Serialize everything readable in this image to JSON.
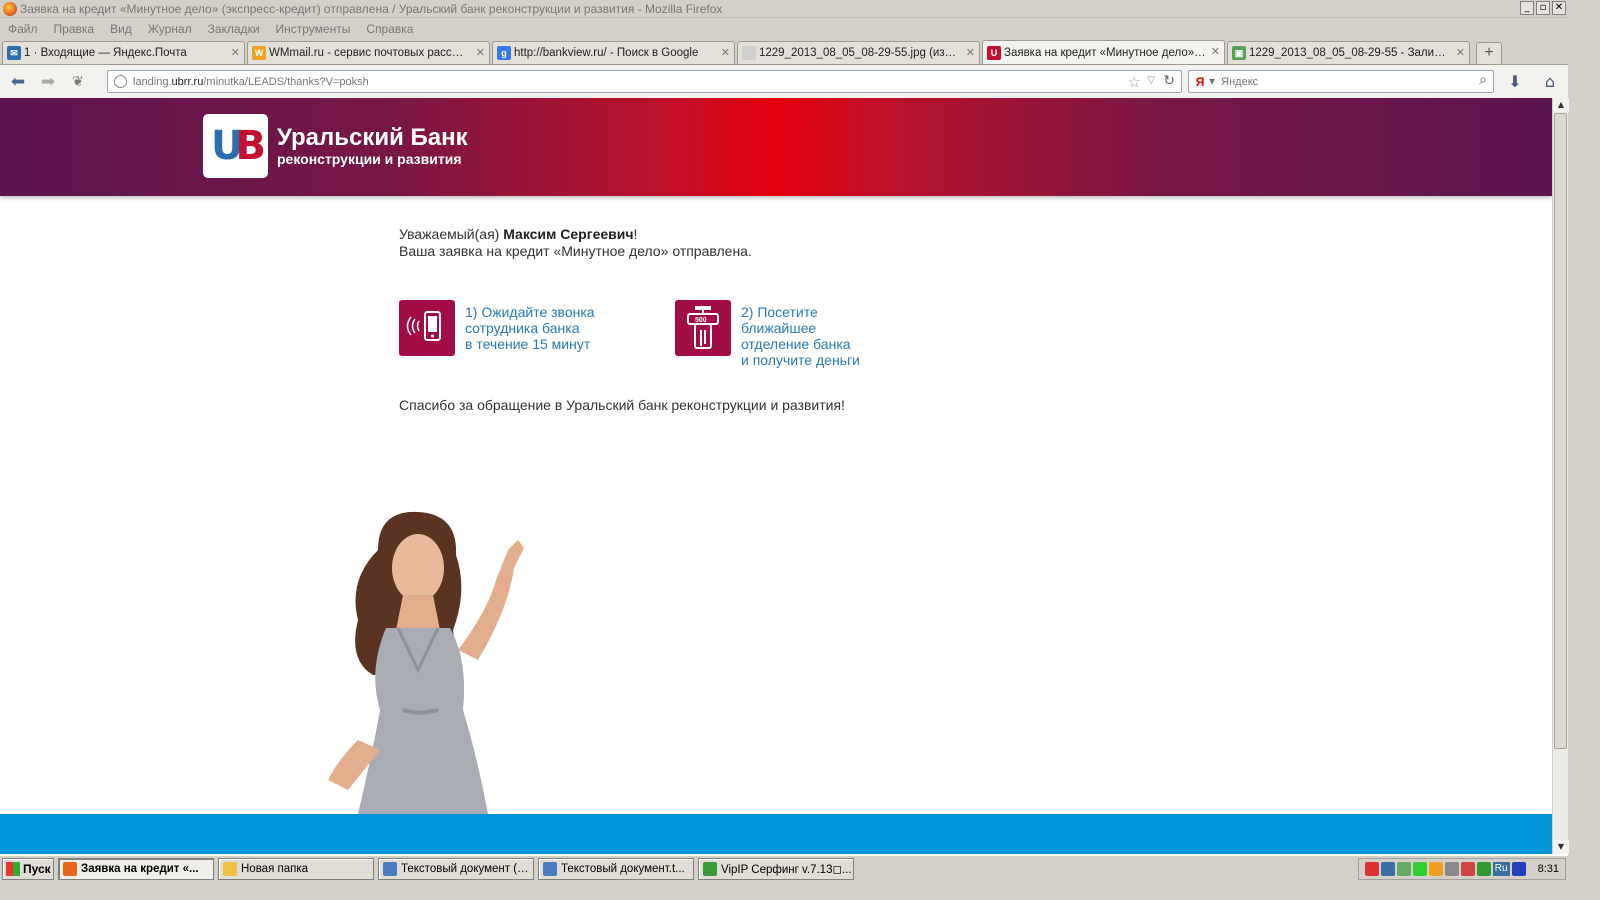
{
  "window": {
    "title": "Заявка на кредит «Минутное дело» (экспресс-кредит) отправлена / Уральский банк реконструкции и развития - Mozilla Firefox",
    "minimize": "_",
    "maximize": "▫",
    "close": "✕"
  },
  "menu": [
    "Файл",
    "Правка",
    "Вид",
    "Журнал",
    "Закладки",
    "Инструменты",
    "Справка"
  ],
  "tabs": [
    {
      "label": "1 · Входящие — Яндекс.Почта",
      "icon_color": "#2b6fb0",
      "icon_glyph": "✉"
    },
    {
      "label": "WMmail.ru - сервис почтовых рассылок...",
      "icon_color": "#f0a020",
      "icon_glyph": "W"
    },
    {
      "label": "http://bankview.ru/ - Поиск в Google",
      "icon_color": "#3b78e7",
      "icon_glyph": "g"
    },
    {
      "label": "1229_2013_08_05_08-29-55.jpg (изобр...",
      "icon_color": "#cfcfcf",
      "icon_glyph": ""
    },
    {
      "label": "Заявка на кредит «Минутное дело» (э...",
      "icon_color": "#c21032",
      "icon_glyph": "U"
    },
    {
      "label": "1229_2013_08_05_08-29-55 - Заливка ...",
      "icon_color": "#5aa05a",
      "icon_glyph": "▣"
    }
  ],
  "active_tab": 4,
  "nav": {
    "back": "⬅",
    "forward": "➡",
    "history": "❦",
    "url_prefix": "landing.",
    "url_domain": "ubrr.ru",
    "url_path": "/minutka/LEADS/thanks?V=poksh",
    "bookmark_star": "☆",
    "url_dropdown": "▽",
    "reload": "↻",
    "search_engine": "Я",
    "search_engine_dropdown": "▼",
    "search_placeholder": "Яндекс",
    "search_icon": "⌕",
    "downloads": "⬇",
    "home": "⌂"
  },
  "page": {
    "brand_line1": "Уральский Банк",
    "brand_line2": "реконструкции и развития",
    "logo_u": "U",
    "logo_b": "B",
    "greeting_prefix": "Уважаемый(ая) ",
    "customer_name": "Максим Сергеевич",
    "greeting_suffix": "!",
    "status_line": "Ваша заявка на кредит «Минутное дело» отправлена.",
    "step1": "1) Ожидайте звонка\nсотрудника банка\nв течение 15 минут",
    "step2": "2) Посетите\nближайшее\nотделение банка\nи получите деньги",
    "atm_amount": "500",
    "thanks": "Спасибо за обращение в Уральский банк реконструкции и развития!"
  },
  "colors": {
    "brand_red": "#e5000e",
    "brand_purple": "#5c1550",
    "step_icon_bg": "#a30d45",
    "step_text": "#2a7ab8",
    "footer_blue": "#0095d8"
  },
  "scrollbar": {
    "up": "▲",
    "down": "▼"
  },
  "taskbar": {
    "start": "Пуск",
    "items": [
      {
        "label": "Заявка на кредит «...",
        "icon_color": "#e8661b"
      },
      {
        "label": "Новая папка",
        "icon_color": "#f0c040"
      },
      {
        "label": "Текстовый документ (6...",
        "icon_color": "#4a7ac0"
      },
      {
        "label": "Текстовый документ.t...",
        "icon_color": "#4a7ac0"
      },
      {
        "label": "VipIP Серфинг  v.7.13◻...",
        "icon_color": "#3a9a3a"
      }
    ],
    "lang": "Ru",
    "clock": "8:31"
  }
}
